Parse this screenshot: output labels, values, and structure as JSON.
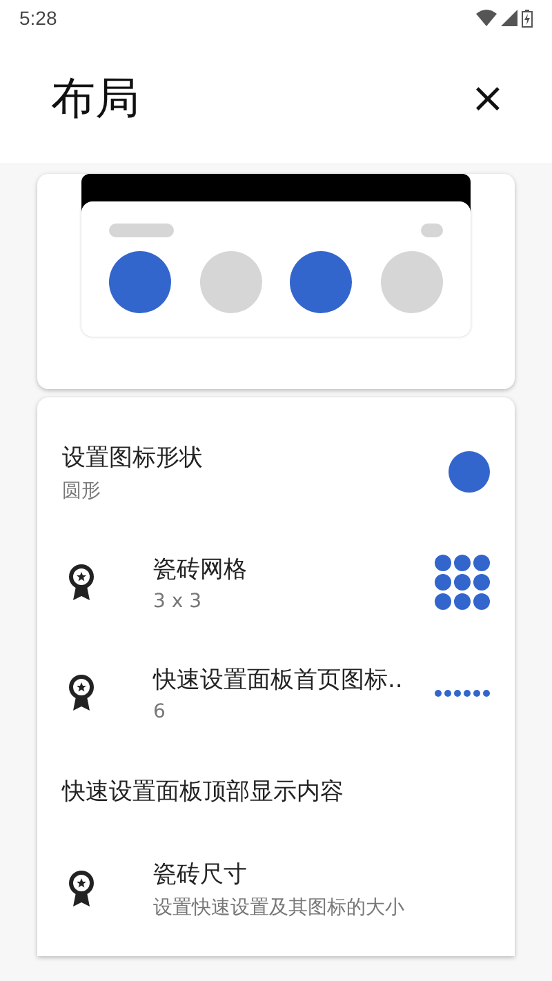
{
  "status_bar": {
    "time": "5:28"
  },
  "header": {
    "title": "布局",
    "close": "×"
  },
  "preview": {
    "tiles": [
      {
        "on": true
      },
      {
        "on": false
      },
      {
        "on": true
      },
      {
        "on": false
      }
    ]
  },
  "settings": [
    {
      "kind": "shape",
      "title": "设置图标形状",
      "subtitle": "圆形"
    },
    {
      "kind": "grid",
      "title": "瓷砖网格",
      "subtitle": "3 x 3"
    },
    {
      "kind": "dots",
      "title": "快速设置面板首页图标..",
      "subtitle": "6"
    },
    {
      "kind": "header",
      "title": "快速设置面板顶部显示内容"
    },
    {
      "kind": "plain",
      "title": "瓷砖尺寸",
      "subtitle": "设置快速设置及其图标的大小"
    }
  ]
}
